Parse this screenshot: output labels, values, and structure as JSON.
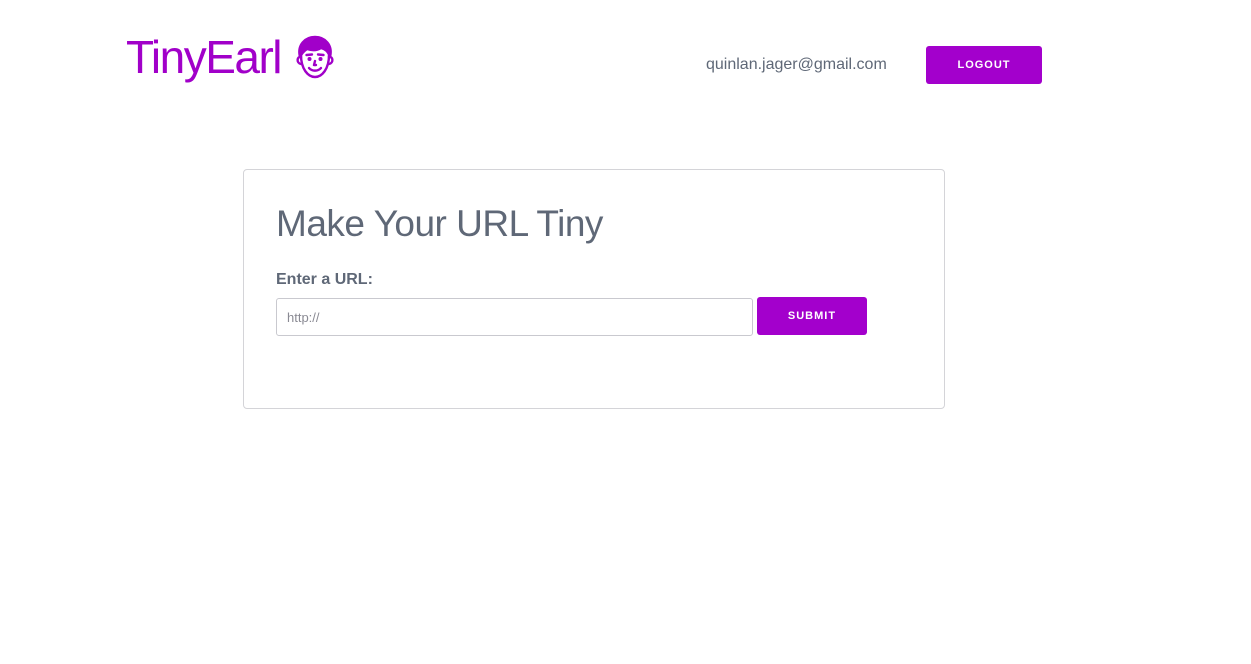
{
  "colors": {
    "brand": "#a100c9",
    "button_bg": "#a300cc",
    "text_muted": "#5f6877"
  },
  "header": {
    "brand_name": "TinyEarl",
    "brand_icon": "boy-face-icon",
    "user_email": "quinlan.jager@gmail.com",
    "logout_label": "LOGOUT"
  },
  "form": {
    "title": "Make Your URL Tiny",
    "url_label": "Enter a URL:",
    "url_placeholder": "http://",
    "url_value": "",
    "submit_label": "SUBMIT"
  }
}
